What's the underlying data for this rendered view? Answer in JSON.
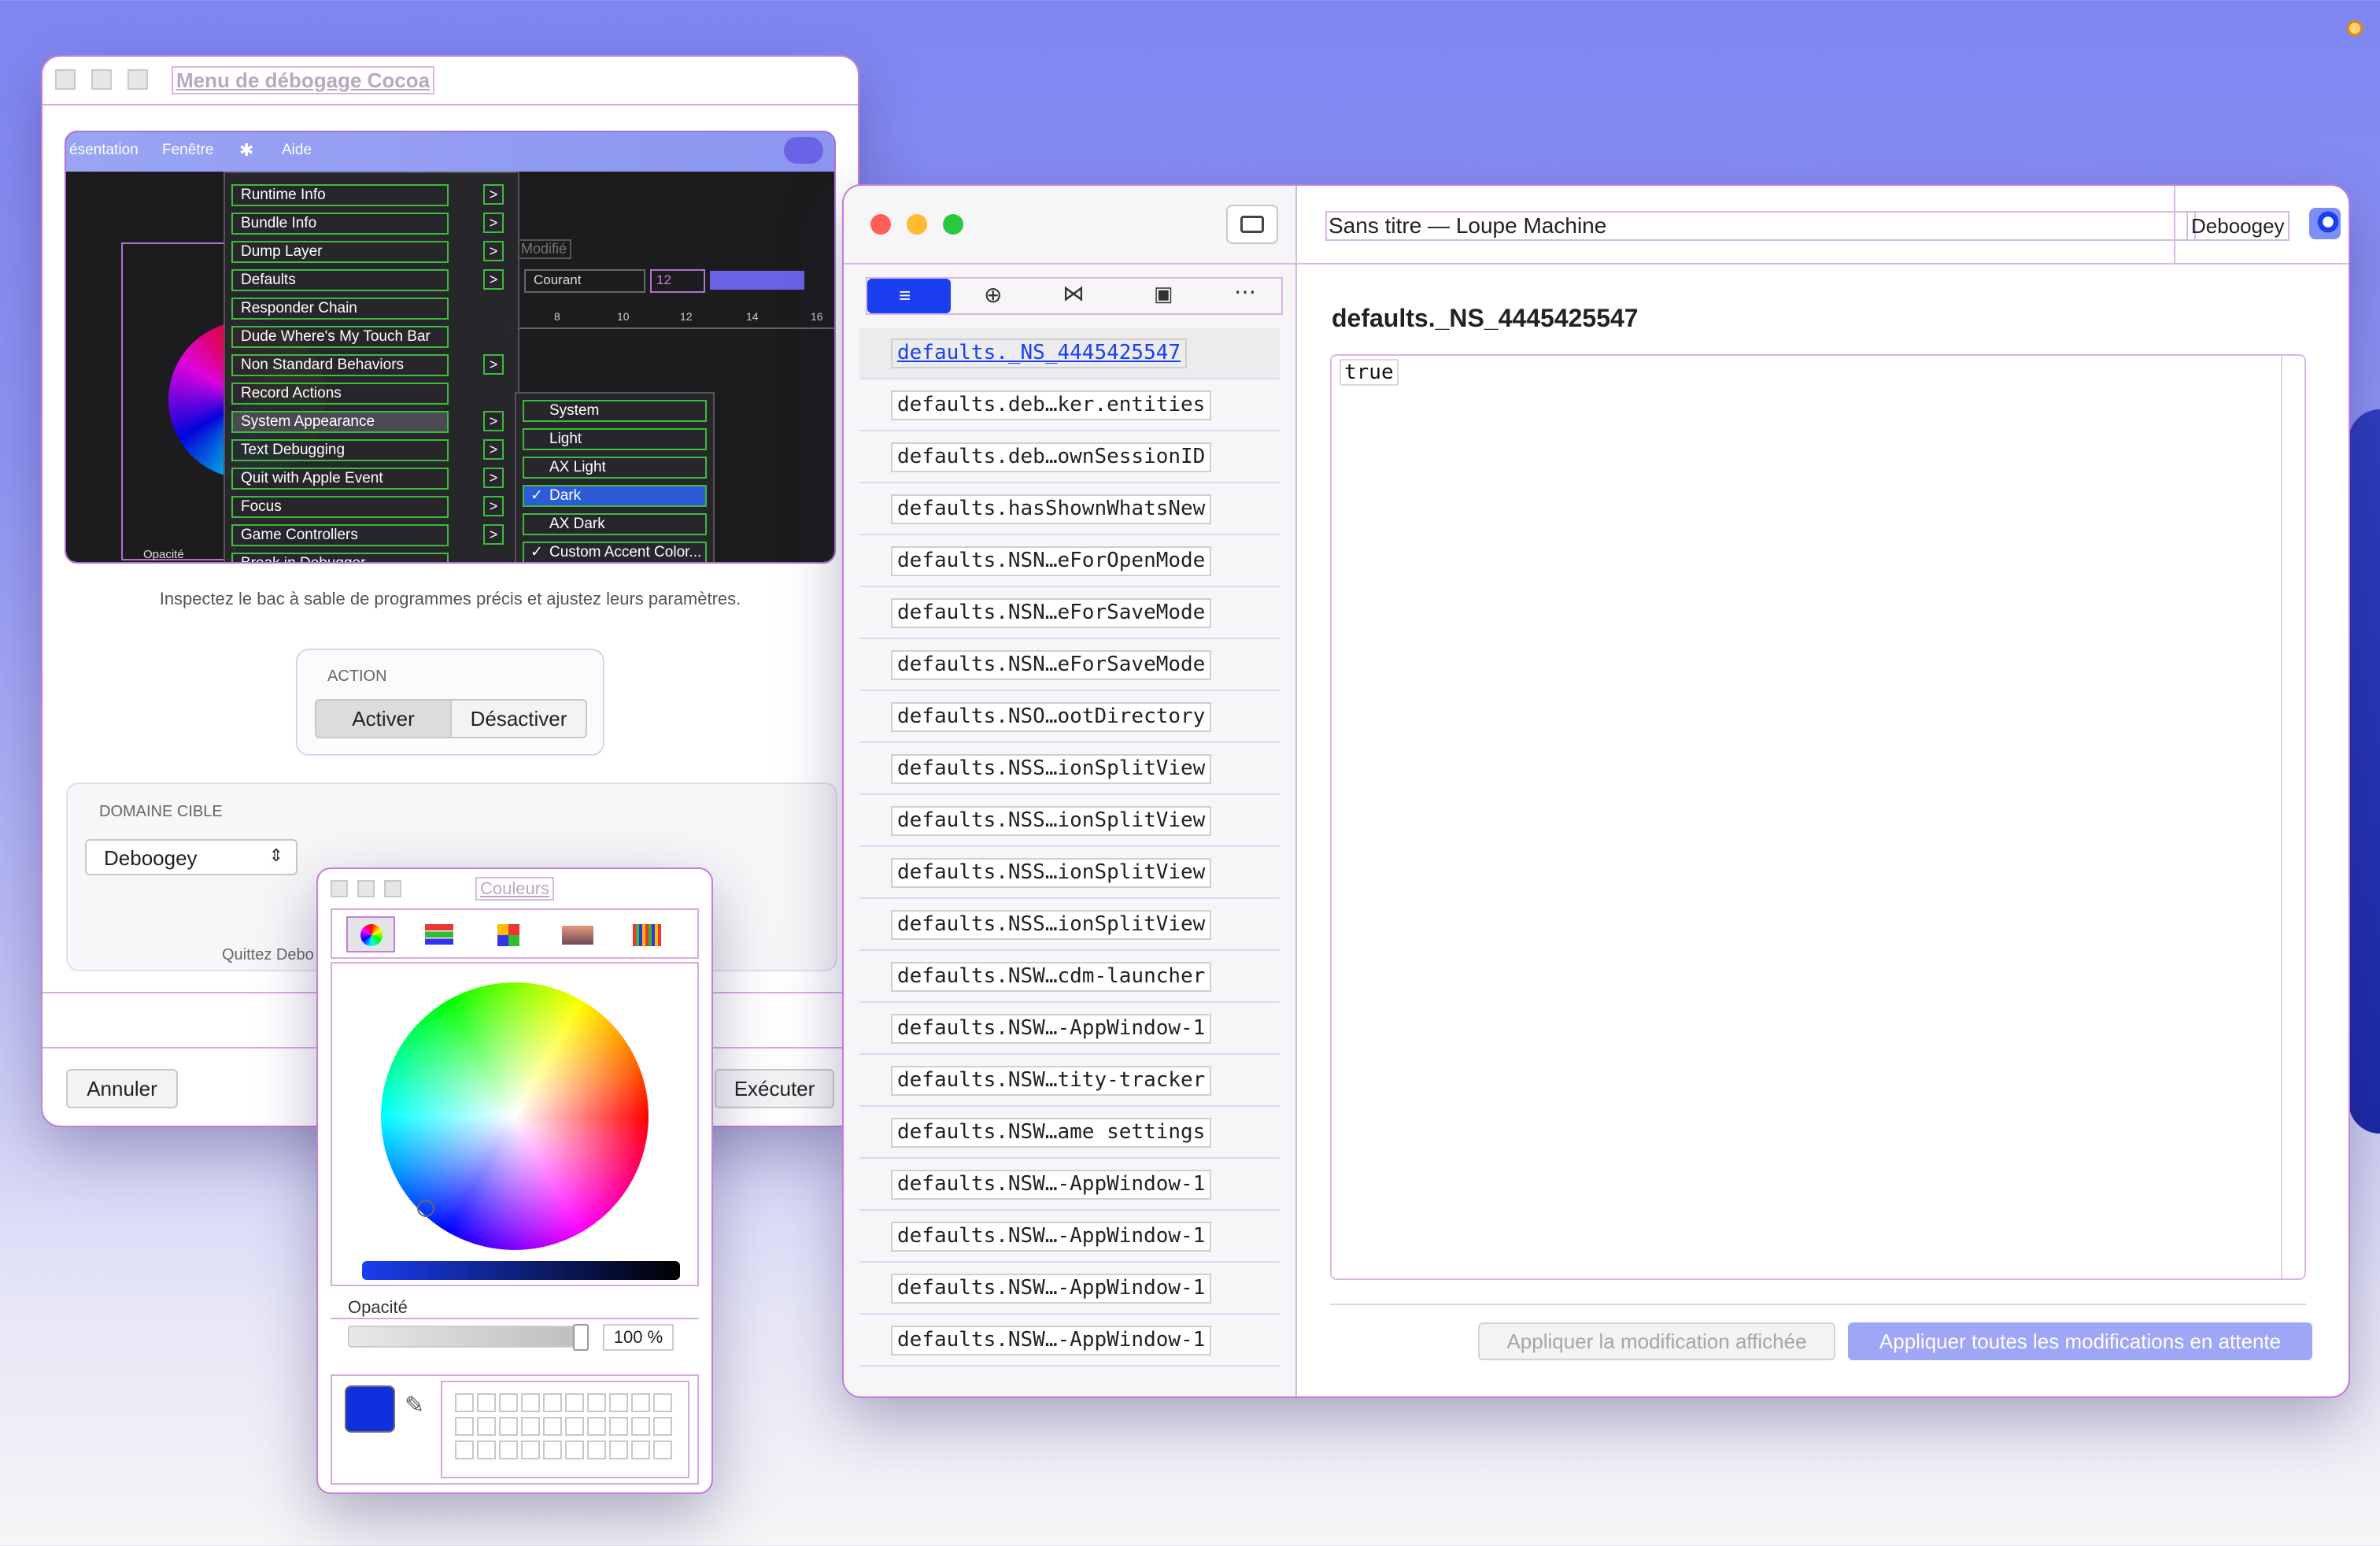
{
  "cocoa_window": {
    "title": "Menu de débogage Cocoa",
    "menubar": [
      "ésentation",
      "Fenêtre",
      "Aide"
    ],
    "description": "Inspectez le bac à sable de programmes précis et ajustez leurs paramètres.",
    "action_label": "ACTION",
    "activate_label": "Activer",
    "deactivate_label": "Désactiver",
    "domain_label": "DOMAINE CIBLE",
    "domain_value": "Deboogey",
    "quit_text": "Quittez Debo",
    "cancel_label": "Annuler",
    "run_label": "Exécuter",
    "preview": {
      "modified": "Modifié",
      "style_value": "Courant",
      "size_value": "12",
      "ruler": [
        "8",
        "10",
        "12",
        "14",
        "16"
      ],
      "opacity_label": "Opacité",
      "menu_items": [
        {
          "label": "Runtime Info",
          "arrow": true
        },
        {
          "label": "Bundle Info",
          "arrow": true
        },
        {
          "label": "Dump Layer",
          "arrow": true
        },
        {
          "label": "Defaults",
          "arrow": true
        },
        {
          "label": "Responder Chain",
          "arrow": false
        },
        {
          "label": "Dude Where's My Touch Bar",
          "arrow": false
        },
        {
          "label": "Non Standard Behaviors",
          "arrow": true
        },
        {
          "label": "Record Actions",
          "arrow": false
        },
        {
          "label": "System Appearance",
          "arrow": true
        },
        {
          "label": "Text Debugging",
          "arrow": true
        },
        {
          "label": "Quit with Apple Event",
          "arrow": true
        },
        {
          "label": "Focus",
          "arrow": true
        },
        {
          "label": "Game Controllers",
          "arrow": true
        },
        {
          "label": "Break in Debugger",
          "arrow": false
        }
      ],
      "submenu_items": [
        {
          "label": "System",
          "checked": false
        },
        {
          "label": "Light",
          "checked": false
        },
        {
          "label": "AX Light",
          "checked": false
        },
        {
          "label": "Dark",
          "checked": true
        },
        {
          "label": "AX Dark",
          "checked": false
        },
        {
          "label": "Custom Accent Color...",
          "checked": true
        }
      ]
    }
  },
  "colors_panel": {
    "title": "Couleurs",
    "opacity_label": "Opacité",
    "opacity_value": "100 %",
    "opacity": 1.0,
    "selected_color": "#1030e0"
  },
  "loupe_window": {
    "title": "Sans titre — Loupe Machine",
    "target_app": "Deboogey",
    "selected_key": "defaults._NS_4445425547",
    "value": "true",
    "apply_shown_label": "Appliquer la modification affichée",
    "apply_all_label": "Appliquer toutes les modifications en attente",
    "keys": [
      "defaults._NS_4445425547",
      "defaults.deb…ker.entities",
      "defaults.deb…ownSessionID",
      "defaults.hasShownWhatsNew",
      "defaults.NSN…eForOpenMode",
      "defaults.NSN…eForSaveMode",
      "defaults.NSN…eForSaveMode",
      "defaults.NSO…ootDirectory",
      "defaults.NSS…ionSplitView",
      "defaults.NSS…ionSplitView",
      "defaults.NSS…ionSplitView",
      "defaults.NSS…ionSplitView",
      "defaults.NSW…cdm-launcher",
      "defaults.NSW…-AppWindow-1",
      "defaults.NSW…tity-tracker",
      "defaults.NSW…ame settings",
      "defaults.NSW…-AppWindow-1",
      "defaults.NSW…-AppWindow-1",
      "defaults.NSW…-AppWindow-1",
      "defaults.NSW…-AppWindow-1"
    ]
  },
  "colors": {
    "accent": "#1a3ef0",
    "debug_outline": "#c77ddb",
    "menu_green": "#3dbb3d"
  }
}
